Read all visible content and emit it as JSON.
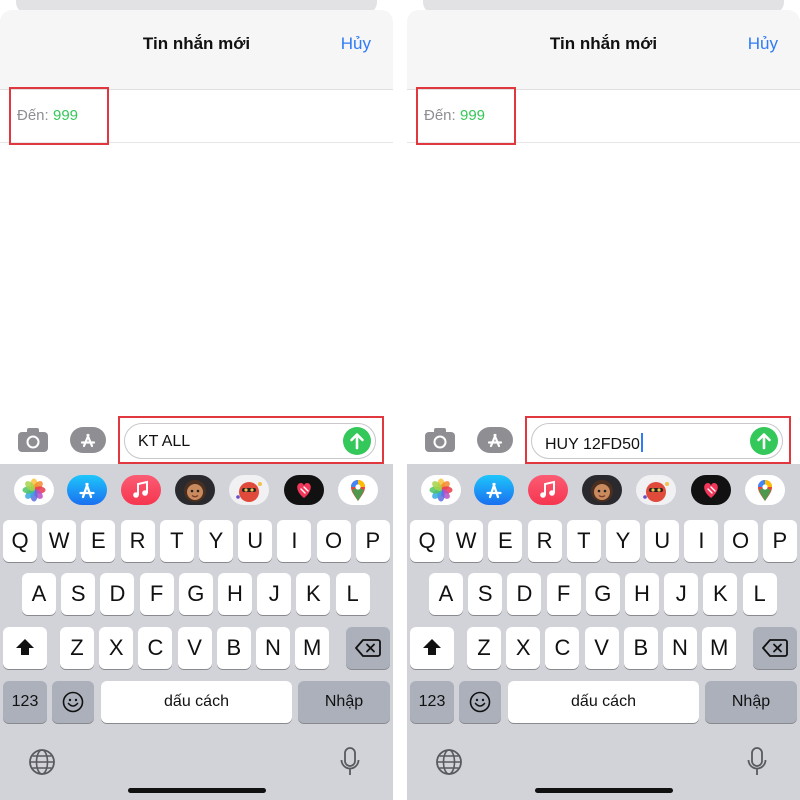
{
  "screens": [
    {
      "title": "Tin nhắn mới",
      "cancel_label": "Hủy",
      "to_label": "Đến:",
      "to_value": "999",
      "message_text": "KT ALL",
      "show_caret": false
    },
    {
      "title": "Tin nhắn mới",
      "cancel_label": "Hủy",
      "to_label": "Đến:",
      "to_value": "999",
      "message_text": "HUY 12FD50",
      "show_caret": true
    }
  ],
  "keyboard": {
    "row1": [
      "Q",
      "W",
      "E",
      "R",
      "T",
      "Y",
      "U",
      "I",
      "O",
      "P"
    ],
    "row2": [
      "A",
      "S",
      "D",
      "F",
      "G",
      "H",
      "J",
      "K",
      "L"
    ],
    "row3": [
      "Z",
      "X",
      "C",
      "V",
      "B",
      "N",
      "M"
    ],
    "numbers_label": "123",
    "space_label": "dấu cách",
    "return_label": "Nhập"
  },
  "app_strip": [
    "photos",
    "app-store",
    "music",
    "memoji",
    "animoji",
    "digital-touch",
    "google-maps"
  ],
  "colors": {
    "accent_blue": "#2f7cf6",
    "recipient_green": "#34c759",
    "send_green": "#34c759",
    "highlight_red": "#e0383e",
    "keyboard_bg": "#d1d3d9"
  }
}
